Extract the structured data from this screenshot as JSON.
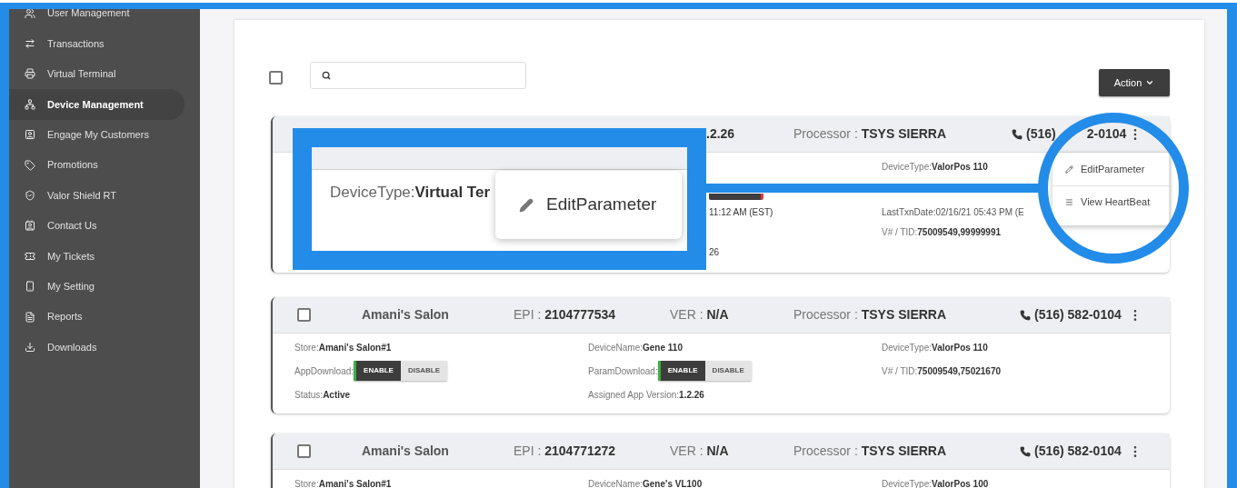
{
  "sidebar": {
    "items": [
      {
        "label": "User Management",
        "selected": false
      },
      {
        "label": "Transactions",
        "selected": false
      },
      {
        "label": "Virtual Terminal",
        "selected": false
      },
      {
        "label": "Device Management",
        "selected": true
      },
      {
        "label": "Engage My Customers",
        "selected": false
      },
      {
        "label": "Promotions",
        "selected": false
      },
      {
        "label": "Valor Shield RT",
        "selected": false
      },
      {
        "label": "Contact Us",
        "selected": false
      },
      {
        "label": "My Tickets",
        "selected": false
      },
      {
        "label": "My Setting",
        "selected": false
      },
      {
        "label": "Reports",
        "selected": false
      },
      {
        "label": "Downloads",
        "selected": false
      }
    ]
  },
  "toolbar": {
    "select_all": {
      "checked": false
    },
    "action_button": "Action"
  },
  "partial_card": {
    "version": ".2.26",
    "processor_label": "Processor : ",
    "processor": "TSYS SIERRA",
    "phone_start": "(516)",
    "phone_end": "2-0104",
    "middle_column": [
      "11:12 AM (EST)",
      "26"
    ],
    "right_column": {
      "device_type_label": "DeviceType:",
      "device_type": "ValorPos 110",
      "last_txn": "LastTxnDate:02/16/21 05:43 PM (E",
      "tid_label": "V# / TID:",
      "tid": "75009549,99999991"
    },
    "menu": [
      {
        "label": "EditParameter",
        "kind": "edit"
      },
      {
        "label": "View HeartBeat",
        "kind": "list"
      }
    ]
  },
  "callout": {
    "label": "DeviceType:",
    "value": "Virtual Ter",
    "popup_item": "EditParameter"
  },
  "devices": [
    {
      "checked": false,
      "name": "Amani's Salon",
      "epi_label": "EPI : ",
      "epi": "2104777534",
      "ver_label": "VER : ",
      "ver": "N/A",
      "processor_label": "Processor : ",
      "processor": "TSYS SIERRA",
      "phone": "(516) 582-0104",
      "fields": [
        {
          "kind": "text",
          "label": "Store:",
          "value": "Amani's Salon#1"
        },
        {
          "kind": "text",
          "label": "DeviceName:",
          "value": "Gene 110"
        },
        {
          "kind": "text",
          "label": "DeviceType:",
          "value": "ValorPos 110"
        },
        {
          "kind": "toggle",
          "label": "AppDownload:",
          "options": [
            {
              "label": "ENABLE",
              "selected": true
            },
            {
              "label": "DISABLE",
              "selected": false
            }
          ]
        },
        {
          "kind": "toggle",
          "label": "ParamDownload:",
          "options": [
            {
              "label": "ENABLE",
              "selected": true
            },
            {
              "label": "DISABLE",
              "selected": false
            }
          ]
        },
        {
          "kind": "text",
          "label": "V# / TID:",
          "value": "75009549,75021670"
        },
        {
          "kind": "text",
          "label": "Status:",
          "value": "Active"
        },
        {
          "kind": "text",
          "label": "Assigned App Version:",
          "value": "1.2.26"
        }
      ]
    },
    {
      "checked": false,
      "name": "Amani's Salon",
      "epi_label": "EPI : ",
      "epi": "2104771272",
      "ver_label": "VER : ",
      "ver": "N/A",
      "processor_label": "Processor : ",
      "processor": "TSYS SIERRA",
      "phone": "(516) 582-0104",
      "fields": [
        {
          "kind": "text",
          "label": "Store:",
          "value": "Amani's Salon#1"
        },
        {
          "kind": "text",
          "label": "DeviceName:",
          "value": "Gene's VL100"
        },
        {
          "kind": "text",
          "label": "DeviceType:",
          "value": "ValorPos 100"
        }
      ]
    }
  ]
}
